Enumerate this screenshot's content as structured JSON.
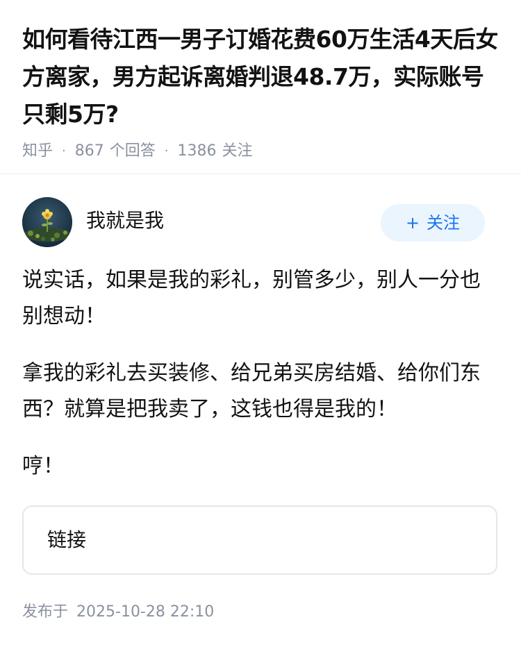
{
  "question": {
    "title": "如何看待江西一男子订婚花费60万生活4天后女方离家，男方起诉离婚判退48.7万，实际账号只剩5万?",
    "source": "知乎",
    "answers_count": "867",
    "answers_label": "个回答",
    "followers_count": "1386",
    "followers_label": "关注"
  },
  "author": {
    "name": "我就是我",
    "avatar_icon": "avatar-flower-photo",
    "follow_plus": "+",
    "follow_label": "关注"
  },
  "answer": {
    "paragraphs": [
      "说实话，如果是我的彩礼，别管多少，别人一分也别想动！",
      "拿我的彩礼去买装修、给兄弟买房结婚、给你们东西？就算是把我卖了，这钱也得是我的！",
      "哼！"
    ]
  },
  "link_card": {
    "label": "链接"
  },
  "footer": {
    "published_label": "发布于",
    "published_time": "2025-10-28 22:10"
  },
  "colors": {
    "accent": "#1772f6",
    "follow_bg": "#ebf5fd",
    "muted_text": "#8a919f",
    "text": "#121212"
  }
}
